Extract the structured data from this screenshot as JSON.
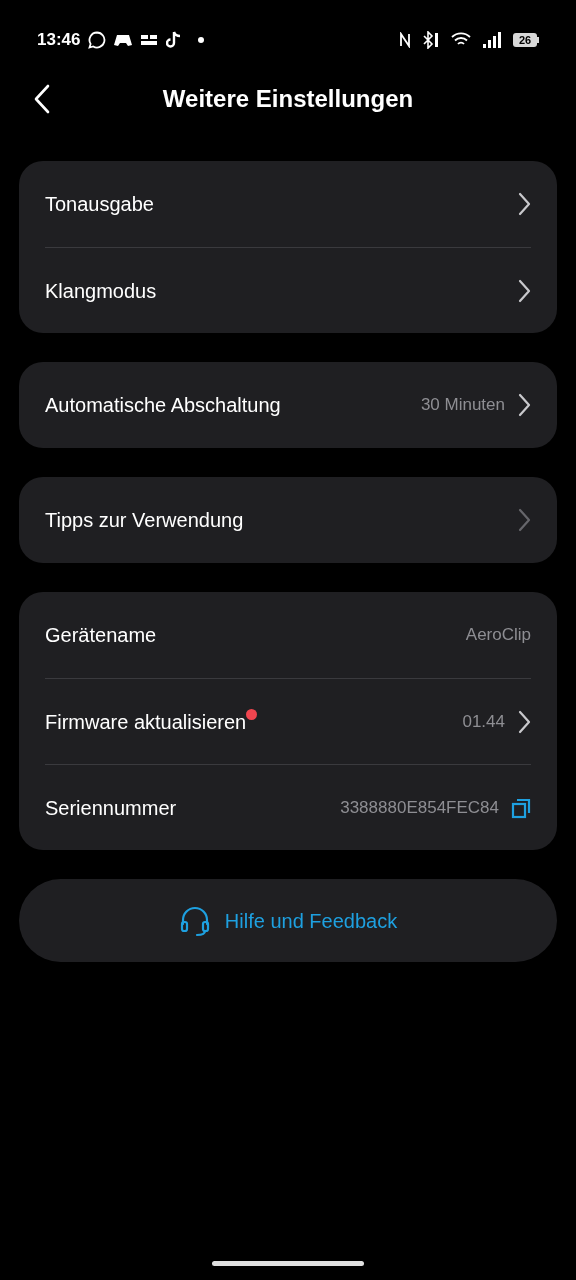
{
  "status_bar": {
    "time": "13:46",
    "battery": "26"
  },
  "header": {
    "title": "Weitere Einstellungen"
  },
  "groups": [
    {
      "rows": [
        {
          "label": "Tonausgabe",
          "kind": "link"
        },
        {
          "label": "Klangmodus",
          "kind": "link"
        }
      ]
    },
    {
      "rows": [
        {
          "label": "Automatische Abschaltung",
          "value": "30 Minuten",
          "kind": "link"
        }
      ]
    },
    {
      "rows": [
        {
          "label": "Tipps zur Verwendung",
          "kind": "dimlink"
        }
      ]
    },
    {
      "rows": [
        {
          "label": "Gerätename",
          "value": "AeroClip",
          "kind": "info"
        },
        {
          "label": "Firmware aktualisieren",
          "badge": true,
          "value": "01.44",
          "kind": "link"
        },
        {
          "label": "Seriennummer",
          "value": "3388880E854FEC84",
          "kind": "copy"
        }
      ]
    }
  ],
  "help_button": {
    "label": "Hilfe und Feedback"
  }
}
